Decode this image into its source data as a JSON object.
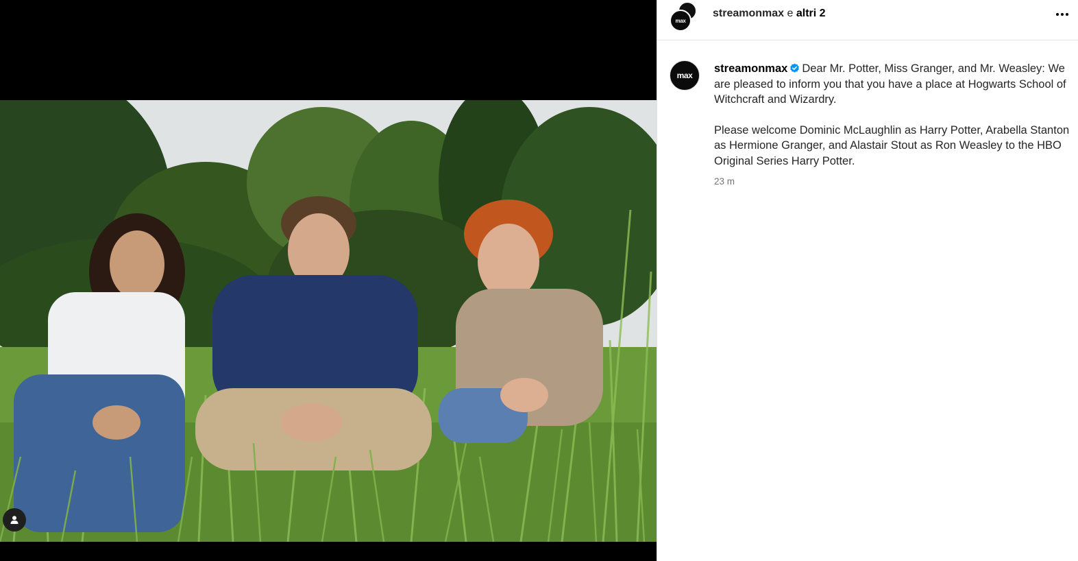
{
  "post": {
    "header": {
      "username": "streamonmax",
      "connector": " e ",
      "others": "altri 2",
      "avatar_text": "max",
      "more_icon": "more-horizontal-icon"
    },
    "caption": {
      "avatar_text": "max",
      "username": "streamonmax",
      "verified_icon": "verified-badge-icon",
      "paragraph1": "Dear Mr. Potter, Miss Granger, and Mr. Weasley: We are pleased to inform you that you have a place at Hogwarts School of Witchcraft and Wizardry.",
      "paragraph2": "Please welcome Dominic McLaughlin as Harry Potter, Arabella Stanton as Hermione Granger, and Alastair Stout as Ron Weasley to the HBO Original Series Harry Potter.",
      "timestamp": "23 m"
    },
    "media": {
      "tag_icon": "user-tag-icon"
    }
  },
  "colors": {
    "text": "#262626",
    "muted": "#737373",
    "verified": "#0095f6",
    "divider": "#e3e3e3"
  }
}
